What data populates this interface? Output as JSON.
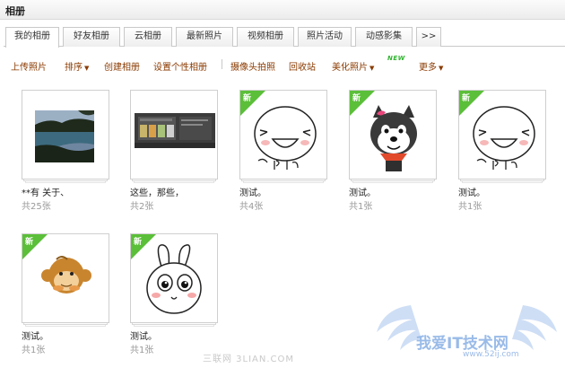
{
  "header": {
    "title": "相册"
  },
  "tabs": [
    {
      "label": "我的相册"
    },
    {
      "label": "好友相册"
    },
    {
      "label": "云相册"
    },
    {
      "label": "最新照片"
    },
    {
      "label": "视频相册"
    },
    {
      "label": "照片活动"
    },
    {
      "label": "动感影集"
    },
    {
      "label": ">>"
    }
  ],
  "actions": {
    "upload": "上传照片",
    "sort": "排序",
    "create": "创建相册",
    "personalize": "设置个性相册",
    "webcam": "摄像头拍照",
    "recycle": "回收站",
    "beautify": "美化照片",
    "new_badge": "NEW",
    "more": "更多"
  },
  "albums": [
    {
      "name": "**有  关于、",
      "count": "共25张",
      "new": false,
      "thumbnail": "lake-photo"
    },
    {
      "name": "这些，那些，",
      "count": "共2张",
      "new": false,
      "thumbnail": "screen-photo"
    },
    {
      "name": "测试。",
      "count": "共4张",
      "new": true,
      "new_label": "新",
      "thumbnail": "laughing-face"
    },
    {
      "name": "测试。",
      "count": "共1张",
      "new": true,
      "new_label": "新",
      "thumbnail": "husky-dog"
    },
    {
      "name": "测试。",
      "count": "共1张",
      "new": true,
      "new_label": "新",
      "thumbnail": "laughing-face"
    },
    {
      "name": "测试。",
      "count": "共1张",
      "new": true,
      "new_label": "新",
      "thumbnail": "monkey"
    },
    {
      "name": "测试。",
      "count": "共1张",
      "new": true,
      "new_label": "新",
      "thumbnail": "rabbit"
    }
  ],
  "watermark": {
    "site": "三联网 3LIAN.COM",
    "logo_text": "我爱IT技术网",
    "logo_url": "www.52ij.com"
  },
  "colors": {
    "action_text": "#8a3a00",
    "new_ribbon": "#5bbf39",
    "new_badge": "#2fb42f",
    "count_text": "#9a9a9a"
  }
}
